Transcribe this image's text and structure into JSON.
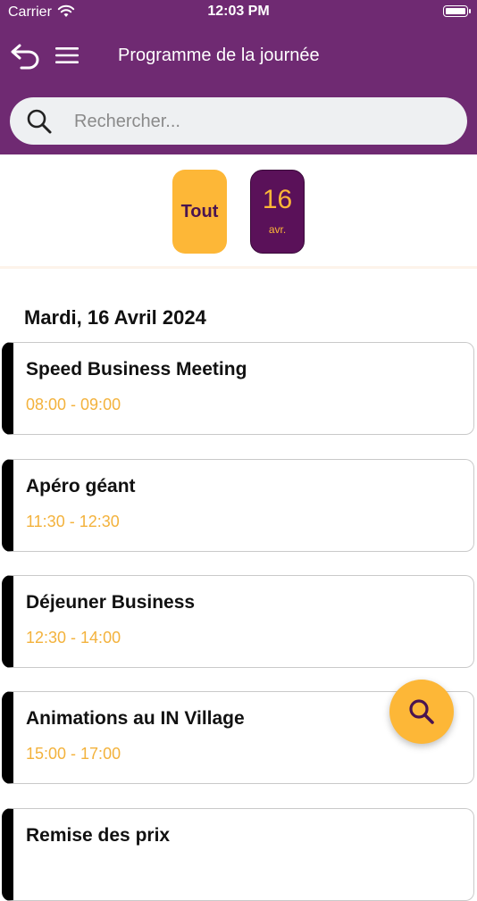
{
  "status_bar": {
    "carrier": "Carrier",
    "time": "12:03 PM"
  },
  "header": {
    "title": "Programme de la journée"
  },
  "search": {
    "placeholder": "Rechercher...",
    "value": ""
  },
  "filters": {
    "all_label": "Tout",
    "date_day": "16",
    "date_month": "avr."
  },
  "schedule": {
    "day_heading": "Mardi, 16 Avril 2024",
    "events": [
      {
        "title": "Speed Business Meeting",
        "time": "08:00 - 09:00"
      },
      {
        "title": "Apéro géant",
        "time": "11:30 - 12:30"
      },
      {
        "title": "Déjeuner Business",
        "time": "12:30 - 14:00"
      },
      {
        "title": "Animations au IN Village",
        "time": "15:00 - 17:00"
      },
      {
        "title": "Remise des prix",
        "time": ""
      }
    ]
  },
  "colors": {
    "header_bg": "#6f2a72",
    "accent": "#fdb737",
    "date_chip_bg": "#5a1159",
    "time_text": "#f3b23c"
  },
  "icons": {
    "back": "back-arrow-icon",
    "menu": "hamburger-menu-icon",
    "search": "search-icon",
    "fab": "search-icon"
  }
}
